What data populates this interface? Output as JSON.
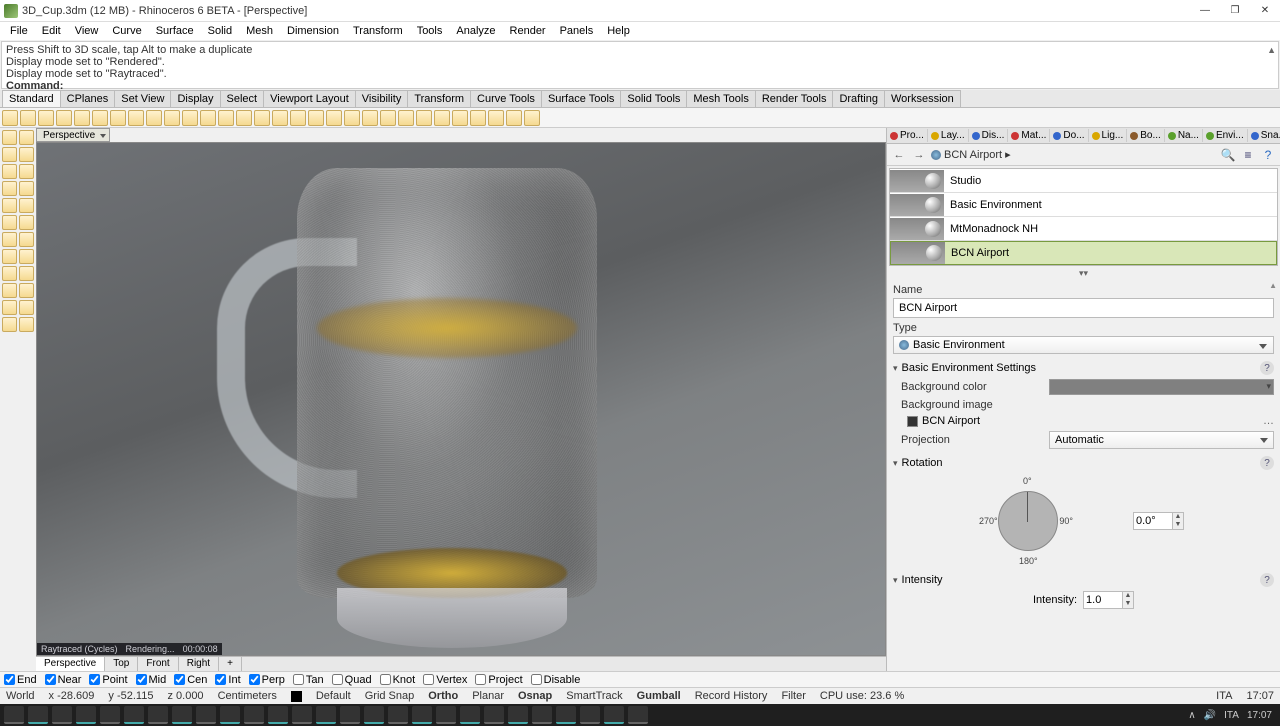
{
  "window": {
    "title": "3D_Cup.3dm (12 MB) - Rhinoceros 6 BETA - [Perspective]"
  },
  "menu": [
    "File",
    "Edit",
    "View",
    "Curve",
    "Surface",
    "Solid",
    "Mesh",
    "Dimension",
    "Transform",
    "Tools",
    "Analyze",
    "Render",
    "Panels",
    "Help"
  ],
  "command_history": {
    "l1": "Press Shift to 3D scale, tap Alt to make a duplicate",
    "l2": "Display mode set to \"Rendered\".",
    "l3": "Display mode set to \"Raytraced\".",
    "prompt": "Command:"
  },
  "toolbar_tabs": [
    "Standard",
    "CPlanes",
    "Set View",
    "Display",
    "Select",
    "Viewport Layout",
    "Visibility",
    "Transform",
    "Curve Tools",
    "Surface Tools",
    "Solid Tools",
    "Mesh Tools",
    "Render Tools",
    "Drafting",
    "Worksession"
  ],
  "viewport": {
    "label": "Perspective",
    "overlay_mode": "Raytraced (Cycles)",
    "overlay_render": "Rendering...",
    "overlay_time": "00:00:08"
  },
  "view_tabs": [
    "Perspective",
    "Top",
    "Front",
    "Right",
    "+"
  ],
  "right_panel": {
    "tabs": [
      {
        "label": "Pro...",
        "color": "#cc3333"
      },
      {
        "label": "Lay...",
        "color": "#d9a700"
      },
      {
        "label": "Dis...",
        "color": "#3366cc"
      },
      {
        "label": "Mat...",
        "color": "#cc3333"
      },
      {
        "label": "Do...",
        "color": "#3366cc"
      },
      {
        "label": "Lig...",
        "color": "#d9a700"
      },
      {
        "label": "Bo...",
        "color": "#8a5a2b"
      },
      {
        "label": "Na...",
        "color": "#5aa02c"
      },
      {
        "label": "Envi...",
        "color": "#5aa02c"
      },
      {
        "label": "Sna...",
        "color": "#3366cc"
      }
    ],
    "breadcrumb": "BCN Airport ▸",
    "env_list": [
      "Studio",
      "Basic Environment",
      "MtMonadnock NH",
      "BCN Airport"
    ],
    "selected_index": 3,
    "name_label": "Name",
    "name_value": "BCN Airport",
    "type_label": "Type",
    "type_value": "Basic Environment",
    "sec_basic": "Basic Environment Settings",
    "bg_color_label": "Background color",
    "bg_color_hex": "#808080",
    "bg_image_label": "Background image",
    "bg_image_value": "BCN Airport",
    "proj_label": "Projection",
    "proj_value": "Automatic",
    "sec_rotation": "Rotation",
    "dial": {
      "d0": "0°",
      "d90": "90°",
      "d180": "180°",
      "d270": "270°"
    },
    "rot_value": "0.0°",
    "sec_intensity": "Intensity",
    "intensity_label": "Intensity:",
    "intensity_value": "1.0"
  },
  "osnap": {
    "items": [
      {
        "label": "End",
        "checked": true
      },
      {
        "label": "Near",
        "checked": true
      },
      {
        "label": "Point",
        "checked": true
      },
      {
        "label": "Mid",
        "checked": true
      },
      {
        "label": "Cen",
        "checked": true
      },
      {
        "label": "Int",
        "checked": true
      },
      {
        "label": "Perp",
        "checked": true
      },
      {
        "label": "Tan",
        "checked": false
      },
      {
        "label": "Quad",
        "checked": false
      },
      {
        "label": "Knot",
        "checked": false
      },
      {
        "label": "Vertex",
        "checked": false
      },
      {
        "label": "Project",
        "checked": false
      },
      {
        "label": "Disable",
        "checked": false
      }
    ]
  },
  "status": {
    "cplane": "World",
    "x": "x -28.609",
    "y": "y -52.115",
    "z": "z 0.000",
    "units": "Centimeters",
    "layer_swatch": "#000000",
    "layer": "Default",
    "grid_snap": "Grid Snap",
    "ortho": "Ortho",
    "planar": "Planar",
    "osnap": "Osnap",
    "smarttrack": "SmartTrack",
    "gumball": "Gumball",
    "history": "Record History",
    "filter": "Filter",
    "cpu": "CPU use: 23.6 %",
    "lang": "ITA",
    "time": "17:07"
  }
}
